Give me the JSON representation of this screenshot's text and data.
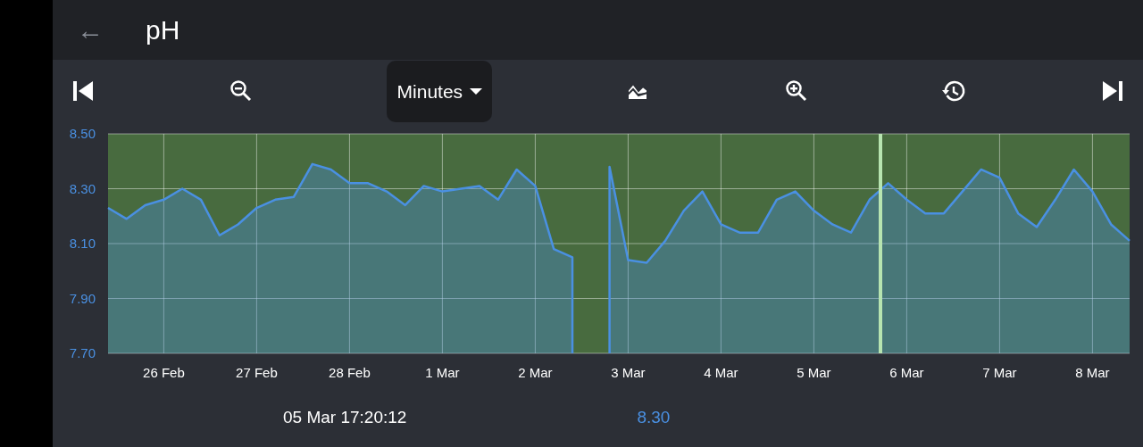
{
  "header": {
    "back_icon": "←",
    "title": "pH"
  },
  "toolbar": {
    "items": [
      {
        "kind": "first"
      },
      {
        "kind": "zoomout"
      },
      {
        "kind": "dropdown",
        "label": "Minutes"
      },
      {
        "kind": "chartstyle"
      },
      {
        "kind": "zoomin"
      },
      {
        "kind": "history"
      },
      {
        "kind": "last"
      }
    ]
  },
  "chart_data": {
    "type": "area",
    "grid": true,
    "ylim": [
      7.7,
      8.5
    ],
    "categories": [
      null,
      null,
      null,
      "26 Feb",
      null,
      null,
      null,
      null,
      "27 Feb",
      null,
      null,
      null,
      null,
      "28 Feb",
      null,
      null,
      null,
      null,
      "1 Mar",
      null,
      null,
      null,
      null,
      "2 Mar",
      null,
      null,
      null,
      null,
      "3 Mar",
      null,
      null,
      null,
      null,
      "4 Mar",
      null,
      null,
      null,
      null,
      "5 Mar",
      null,
      null,
      null,
      null,
      "6 Mar",
      null,
      null,
      null,
      null,
      "7 Mar",
      null,
      null,
      null,
      null,
      "8 Mar",
      null,
      null
    ],
    "yticks": [
      {
        "value": 7.7,
        "label": "7.70"
      },
      {
        "value": 7.9,
        "label": "7.90"
      },
      {
        "value": 8.1,
        "label": "8.10"
      },
      {
        "value": 8.3,
        "label": "8.30"
      },
      {
        "value": 8.5,
        "label": "8.50"
      }
    ],
    "series": [
      {
        "color": "#4a90e2",
        "values": [
          8.23,
          8.19,
          8.24,
          8.26,
          8.3,
          8.26,
          8.13,
          8.17,
          8.23,
          8.26,
          8.27,
          8.39,
          8.37,
          8.32,
          8.32,
          8.29,
          8.24,
          8.31,
          8.29,
          8.3,
          8.31,
          8.26,
          8.37,
          8.31,
          8.08,
          8.05,
          null,
          8.38,
          8.04,
          8.03,
          8.11,
          8.22,
          8.29,
          8.17,
          8.14,
          8.14,
          8.26,
          8.29,
          8.22,
          8.17,
          8.14,
          8.26,
          8.32,
          8.26,
          8.21,
          8.21,
          8.29,
          8.37,
          8.34,
          8.21,
          8.16,
          8.26,
          8.37,
          8.29,
          8.17,
          8.11
        ]
      }
    ]
  },
  "readout": {
    "time": "05 Mar 17:20:12",
    "value": "8.30"
  }
}
